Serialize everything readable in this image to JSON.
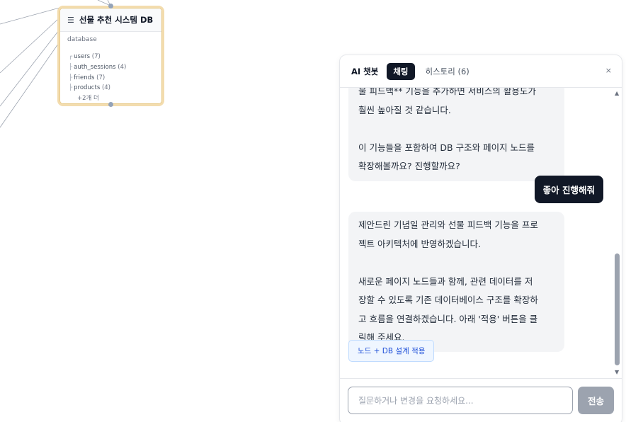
{
  "db_node": {
    "title": "선물 추천 시스템 DB",
    "type_label": "database",
    "tables": [
      {
        "name": "users",
        "count": "(7)"
      },
      {
        "name": "auth_sessions",
        "count": "(4)"
      },
      {
        "name": "friends",
        "count": "(7)"
      },
      {
        "name": "products",
        "count": "(4)"
      }
    ],
    "more_label": "+2개 더",
    "menu_icon": "☰"
  },
  "chat": {
    "app_name": "AI 챗봇",
    "tabs": [
      {
        "label": "채팅",
        "active": true
      },
      {
        "label": "히스토리 (6)",
        "active": false
      }
    ],
    "close_icon": "×",
    "messages": {
      "ai_1": {
        "lines": [
          "물 피드백** 기능을 추가하면 서비스의 활용도가",
          "훨씬 높아질 것 같습니다.",
          "",
          "이 기능들을 포함하여 DB 구조와 페이지 노드를",
          "확장해볼까요? 진행할까요?"
        ]
      },
      "user_1": "좋아 진행해줘",
      "ai_2": {
        "lines": [
          "제안드린 기념일 관리와 선물 피드백 기능을 프로",
          "젝트 아키텍처에 반영하겠습니다.",
          "",
          "새로운 페이지 노드들과 함께, 관련 데이터를 저",
          "장할 수 있도록 기존 데이터베이스 구조를 확장하",
          "고 흐름을 연결하겠습니다. 아래 '적용' 버튼을 클",
          "릭해 주세요."
        ]
      }
    },
    "apply_button": "노드 + DB 설계 적용",
    "input_placeholder": "질문하거나 변경을 요청하세요...",
    "send_button": "전송"
  },
  "colors": {
    "node_border": "#f3dcae",
    "active_tab": "#111827",
    "apply_bg": "#eff6ff",
    "apply_text": "#1d4ed8",
    "send_disabled": "#9ca3af"
  }
}
